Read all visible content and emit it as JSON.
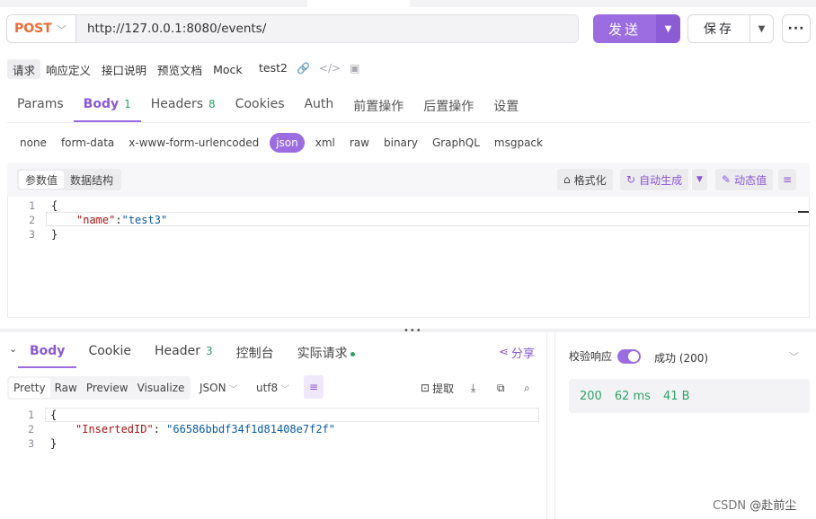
{
  "request": {
    "method": "POST",
    "url": "http://127.0.0.1:8080/events/",
    "send_label": "发送",
    "save_label": "保存"
  },
  "doc_tabs": [
    "请求",
    "响应定义",
    "接口说明",
    "预览文档",
    "Mock"
  ],
  "doc_name": "test2",
  "request_tabs": [
    {
      "label": "Params",
      "count": ""
    },
    {
      "label": "Body",
      "count": "1"
    },
    {
      "label": "Headers",
      "count": "8"
    },
    {
      "label": "Cookies",
      "count": ""
    },
    {
      "label": "Auth",
      "count": ""
    },
    {
      "label": "前置操作",
      "count": ""
    },
    {
      "label": "后置操作",
      "count": ""
    },
    {
      "label": "设置",
      "count": ""
    }
  ],
  "active_request_tab": "Body",
  "body_types": [
    "none",
    "form-data",
    "x-www-form-urlencoded",
    "json",
    "xml",
    "raw",
    "binary",
    "GraphQL",
    "msgpack"
  ],
  "active_body_type": "json",
  "editor_toolbar": {
    "seg": [
      "参数值",
      "数据结构"
    ],
    "format": "格式化",
    "auto_generate": "自动生成",
    "dynamic_value": "动态值"
  },
  "request_body": {
    "line_numbers": [
      "1",
      "2",
      "3"
    ],
    "open": "{",
    "key": "\"name\"",
    "colon": ":",
    "value": "\"test3\"",
    "close": "}"
  },
  "response_tabs": [
    {
      "label": "Body",
      "count": ""
    },
    {
      "label": "Cookie",
      "count": ""
    },
    {
      "label": "Header",
      "count": "3"
    },
    {
      "label": "控制台",
      "count": ""
    },
    {
      "label": "实际请求",
      "count": ""
    }
  ],
  "share_label": "分享",
  "response_toolbar": {
    "views": [
      "Pretty",
      "Raw",
      "Preview",
      "Visualize"
    ],
    "format": "JSON",
    "encoding": "utf8",
    "extract": "提取"
  },
  "response_body": {
    "line_numbers": [
      "1",
      "2",
      "3"
    ],
    "open": "{",
    "key": "\"InsertedID\"",
    "colon": ": ",
    "value": "\"66586bbdf34f1d81408e7f2f\"",
    "close": "}"
  },
  "response_meta": {
    "validate_label": "校验响应",
    "validate_on": true,
    "result": "成功 (200)",
    "status": "200",
    "time": "62 ms",
    "size": "41 B"
  },
  "watermark": {
    "prefix": "CSDN ",
    "author": "@赴前尘"
  },
  "colors": {
    "accent": "#9b6de0",
    "method": "#f26b32",
    "success": "#2ea26a"
  }
}
